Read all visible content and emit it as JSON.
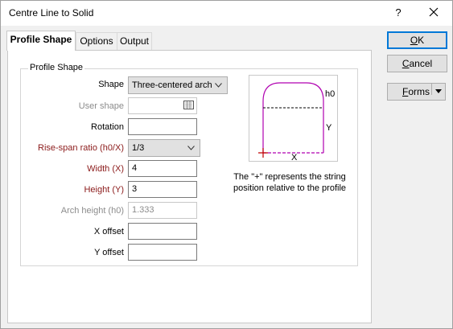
{
  "window": {
    "title": "Centre Line to Solid",
    "help_label": "?"
  },
  "tabs": [
    {
      "label": "Profile Shape",
      "active": true
    },
    {
      "label": "Options",
      "active": false
    },
    {
      "label": "Output",
      "active": false
    }
  ],
  "group": {
    "label": "Profile Shape"
  },
  "fields": {
    "shape": {
      "label": "Shape",
      "value": "Three-centered arch"
    },
    "user_shape": {
      "label": "User shape",
      "value": ""
    },
    "rotation": {
      "label": "Rotation",
      "value": ""
    },
    "rise_span": {
      "label": "Rise-span ratio (h0/X)",
      "value": "1/3"
    },
    "width": {
      "label": "Width (X)",
      "value": "4"
    },
    "height": {
      "label": "Height (Y)",
      "value": "3"
    },
    "arch_height": {
      "label": "Arch height (h0)",
      "value": "1.333"
    },
    "x_offset": {
      "label": "X offset",
      "value": ""
    },
    "y_offset": {
      "label": "Y offset",
      "value": ""
    }
  },
  "preview": {
    "h0": "h0",
    "y": "Y",
    "x": "X"
  },
  "description": "The \"+\" represents the string position relative to the profile",
  "buttons": {
    "ok": {
      "label": "OK",
      "hotkey": "O",
      "rest": "K"
    },
    "cancel": {
      "label": "Cancel",
      "hotkey": "C",
      "rest": "ancel"
    },
    "forms": {
      "label": "Forms",
      "hotkey": "F",
      "rest": "orms"
    }
  },
  "colors": {
    "label_red": "#8b1a1a",
    "arch": "#b000b0",
    "default_border": "#0078d7"
  }
}
